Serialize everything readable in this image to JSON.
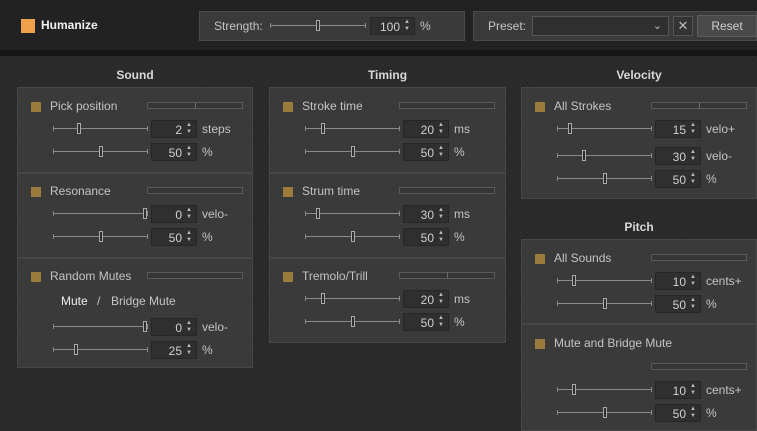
{
  "header": {
    "title": "Humanize",
    "enabled": true,
    "strength": {
      "label": "Strength:",
      "value": "100",
      "unit": "%",
      "slider_pos": 0.5
    },
    "preset": {
      "label": "Preset:",
      "selected": "",
      "clear_icon": "x-icon",
      "reset_label": "Reset"
    }
  },
  "sections": {
    "sound": {
      "title": "Sound",
      "groups": [
        {
          "name": "Pick position",
          "rows": [
            {
              "value": "2",
              "unit": "steps",
              "pos": 0.27
            },
            {
              "value": "50",
              "unit": "%",
              "pos": 0.5
            }
          ]
        },
        {
          "name": "Resonance",
          "rows": [
            {
              "value": "0",
              "unit": "velo-",
              "pos": 1.0
            },
            {
              "value": "50",
              "unit": "%",
              "pos": 0.5
            }
          ]
        },
        {
          "name": "Random Mutes",
          "mute_label": "Mute",
          "mute_sep": "/",
          "bridge_label": "Bridge Mute",
          "rows": [
            {
              "value": "0",
              "unit": "velo-",
              "pos": 1.0
            },
            {
              "value": "25",
              "unit": "%",
              "pos": 0.24
            }
          ]
        }
      ]
    },
    "timing": {
      "title": "Timing",
      "groups": [
        {
          "name": "Stroke time",
          "rows": [
            {
              "value": "20",
              "unit": "ms",
              "pos": 0.19
            },
            {
              "value": "50",
              "unit": "%",
              "pos": 0.5
            }
          ]
        },
        {
          "name": "Strum time",
          "rows": [
            {
              "value": "30",
              "unit": "ms",
              "pos": 0.14
            },
            {
              "value": "50",
              "unit": "%",
              "pos": 0.5
            }
          ]
        },
        {
          "name": "Tremolo/Trill",
          "rows": [
            {
              "value": "20",
              "unit": "ms",
              "pos": 0.19
            },
            {
              "value": "50",
              "unit": "%",
              "pos": 0.5
            }
          ]
        }
      ]
    },
    "velocity": {
      "title": "Velocity",
      "groups": [
        {
          "name": "All Strokes",
          "rows": [
            {
              "value": "15",
              "unit": "velo+",
              "pos": 0.14
            },
            {
              "value": "30",
              "unit": "velo-",
              "pos": 0.28
            },
            {
              "value": "50",
              "unit": "%",
              "pos": 0.5
            }
          ]
        }
      ]
    },
    "pitch": {
      "title": "Pitch",
      "groups": [
        {
          "name": "All Sounds",
          "rows": [
            {
              "value": "10",
              "unit": "cents+",
              "pos": 0.18
            },
            {
              "value": "50",
              "unit": "%",
              "pos": 0.5
            }
          ]
        },
        {
          "name": "Mute and Bridge Mute",
          "rows": [
            {
              "value": "10",
              "unit": "cents+",
              "pos": 0.18
            },
            {
              "value": "50",
              "unit": "%",
              "pos": 0.5
            }
          ]
        }
      ]
    }
  },
  "colors": {
    "accent": "#f0a24a",
    "checkbox": "#9a7b3c",
    "panel": "#3a3a3a"
  }
}
